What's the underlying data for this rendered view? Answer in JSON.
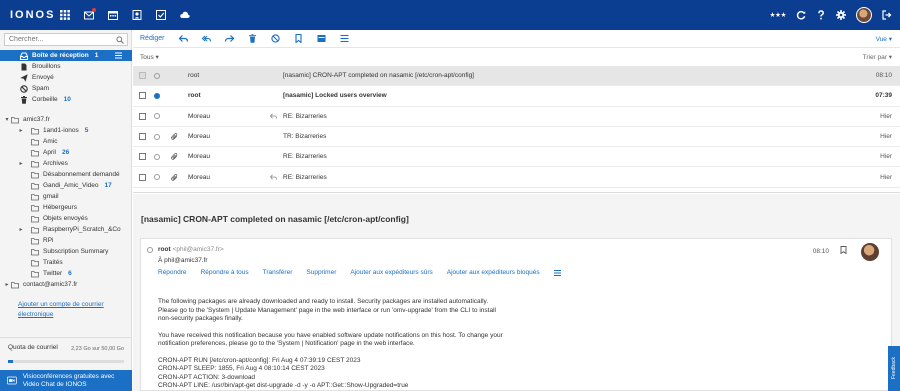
{
  "app": {
    "logo": "IONOS"
  },
  "search": {
    "placeholder": "Chercher..."
  },
  "sidebar": {
    "main_folders": [
      {
        "label": "Boîte de réception",
        "count": "1",
        "icon": "inbox-icon"
      },
      {
        "label": "Brouillons",
        "count": "",
        "icon": "file-icon"
      },
      {
        "label": "Envoyé",
        "count": "",
        "icon": "send-icon"
      },
      {
        "label": "Spam",
        "count": "",
        "icon": "ban-icon"
      },
      {
        "label": "Corbeille",
        "count": "10",
        "icon": "trash-icon"
      }
    ],
    "account1": "amic37.fr",
    "subfolders": [
      {
        "label": "1and1-ionos",
        "count": "5",
        "caret": true
      },
      {
        "label": "Amic",
        "count": "",
        "caret": false
      },
      {
        "label": "April",
        "count": "26",
        "caret": false
      },
      {
        "label": "Archives",
        "count": "",
        "caret": true
      },
      {
        "label": "Désabonnement demandé",
        "count": "",
        "caret": false
      },
      {
        "label": "Gandi_Amic_Video",
        "count": "17",
        "caret": false
      },
      {
        "label": "gmail",
        "count": "",
        "caret": false
      },
      {
        "label": "Hébergeurs",
        "count": "",
        "caret": false
      },
      {
        "label": "Objets envoyés",
        "count": "",
        "caret": false
      },
      {
        "label": "RaspberryPi_Scratch_&Co",
        "count": "",
        "caret": true
      },
      {
        "label": "RPi",
        "count": "",
        "caret": false
      },
      {
        "label": "Subscription Summary",
        "count": "",
        "caret": false
      },
      {
        "label": "Traités",
        "count": "",
        "caret": false
      },
      {
        "label": "Twitter",
        "count": "6",
        "caret": false
      }
    ],
    "account2": "contact@amic37.fr",
    "add_account": "Ajouter un compte de courrier électronique",
    "quota": {
      "label": "Quota de courriel",
      "value": "2,23 Go sur 50,00 Go",
      "used_fraction": 0.045
    },
    "video_banner": "Visioconférences gratuites avec Vidéo Chat de IONOS"
  },
  "toolbar": {
    "compose": "Rédiger",
    "view": "Vue ▾",
    "all": "Tous ▾",
    "sort": "Trier par ▾"
  },
  "messages": [
    {
      "from": "root",
      "subject": "[nasamic] CRON-APT completed on nasamic [/etc/cron-apt/config]",
      "date": "08:10",
      "selected": true,
      "unread": false,
      "attach": false,
      "replied": false
    },
    {
      "from": "root",
      "subject": "[nasamic] Locked users overview",
      "date": "07:39",
      "selected": false,
      "unread": true,
      "attach": false,
      "replied": false
    },
    {
      "from": "Moreau",
      "subject": "RE: Bizarreries",
      "date": "Hier",
      "selected": false,
      "unread": false,
      "attach": false,
      "replied": true
    },
    {
      "from": "Moreau",
      "subject": "TR: Bizarreries",
      "date": "Hier",
      "selected": false,
      "unread": false,
      "attach": true,
      "replied": false
    },
    {
      "from": "Moreau",
      "subject": "RE: Bizarreries",
      "date": "Hier",
      "selected": false,
      "unread": false,
      "attach": true,
      "replied": false
    },
    {
      "from": "Moreau",
      "subject": "RE: Bizarreries",
      "date": "Hier",
      "selected": false,
      "unread": false,
      "attach": true,
      "replied": true
    }
  ],
  "reading": {
    "title": "[nasamic] CRON-APT completed on nasamic [/etc/cron-apt/config]",
    "from_name": "root",
    "from_email": "<phil@amic37.fr>",
    "to": "À  phil@amic37.fr",
    "time": "08:10",
    "actions": [
      "Répondre",
      "Répondre à tous",
      "Transférer",
      "Supprimer",
      "Ajouter aux expéditeurs sûrs",
      "Ajouter aux expéditeurs bloqués"
    ],
    "body": [
      "The following packages are already downloaded and ready to install. Security packages are installed automatically.\nPlease go to the 'System | Update Management' page in the web interface or run 'omv-upgrade' from the CLI to install\nnon-security packages finally.",
      "You have received this notification because you have enabled software update notifications on this host. To change your\nnotification preferences, please go to the 'System | Notification' page in the web interface.",
      "CRON-APT RUN [/etc/cron-apt/config]: Fri Aug  4 07:39:19 CEST 2023\nCRON-APT SLEEP: 1855, Fri Aug  4 08:10:14 CEST 2023\nCRON-APT ACTION: 3-download\nCRON-APT LINE: /usr/bin/apt-get  dist-upgrade -d -y -o APT::Get::Show-Upgraded=true\nReading package lists..."
    ]
  },
  "feedback": "Feedback",
  "colors": {
    "brand": "#0b3d91",
    "accent": "#1b6fc4"
  }
}
